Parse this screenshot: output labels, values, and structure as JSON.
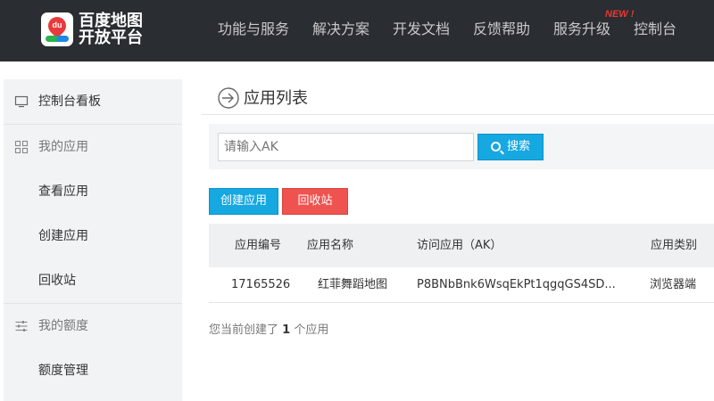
{
  "header": {
    "brand_line1": "百度地图",
    "brand_line2": "开放平台",
    "nav": [
      "功能与服务",
      "解决方案",
      "开发文档",
      "反馈帮助",
      "服务升级",
      "控制台"
    ],
    "new_badge": "NEW !"
  },
  "sidebar": {
    "items": [
      {
        "label": "控制台看板",
        "icon": "monitor-icon"
      },
      {
        "label": "我的应用",
        "icon": "grid-icon"
      },
      {
        "label": "查看应用"
      },
      {
        "label": "创建应用"
      },
      {
        "label": "回收站"
      },
      {
        "label": "我的额度",
        "icon": "sliders-icon"
      },
      {
        "label": "额度管理"
      }
    ]
  },
  "main": {
    "title": "应用列表",
    "search": {
      "placeholder": "请输入AK",
      "button": "搜索"
    },
    "buttons": {
      "create": "创建应用",
      "recycle": "回收站"
    },
    "table": {
      "headers": [
        "应用编号",
        "应用名称",
        "访问应用（AK）",
        "应用类别"
      ],
      "rows": [
        [
          "17165526",
          "红菲舞蹈地图",
          "P8BNbBnk6WsqEkPt1qgqGS4SD...",
          "浏览器端"
        ]
      ]
    },
    "summary": {
      "prefix": "您当前创建了",
      "count": "1",
      "suffix": "个应用"
    }
  },
  "colors": {
    "header_bg": "#2a2d31",
    "primary": "#16a8e0",
    "danger": "#ef5350"
  }
}
